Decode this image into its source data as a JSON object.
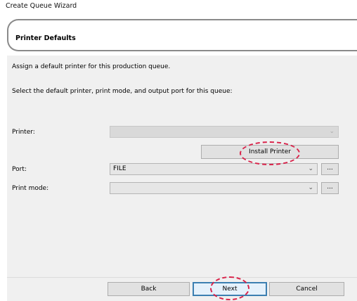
{
  "window": {
    "title": "Create Queue Wizard"
  },
  "header": {
    "title": "Printer Defaults"
  },
  "body": {
    "intro": "Assign a default printer for this production queue.",
    "instructions": "Select the default printer, print mode, and output port for this queue:"
  },
  "fields": {
    "printer": {
      "label": "Printer:",
      "value": "",
      "disabled": true
    },
    "install_button": "Install Printer",
    "port": {
      "label": "Port:",
      "value": "FILE"
    },
    "print_mode": {
      "label": "Print mode:",
      "value": ""
    },
    "browse_label": "..."
  },
  "footer": {
    "back": "Back",
    "next": "Next",
    "cancel": "Cancel"
  },
  "annotation_color": "#d9234a"
}
